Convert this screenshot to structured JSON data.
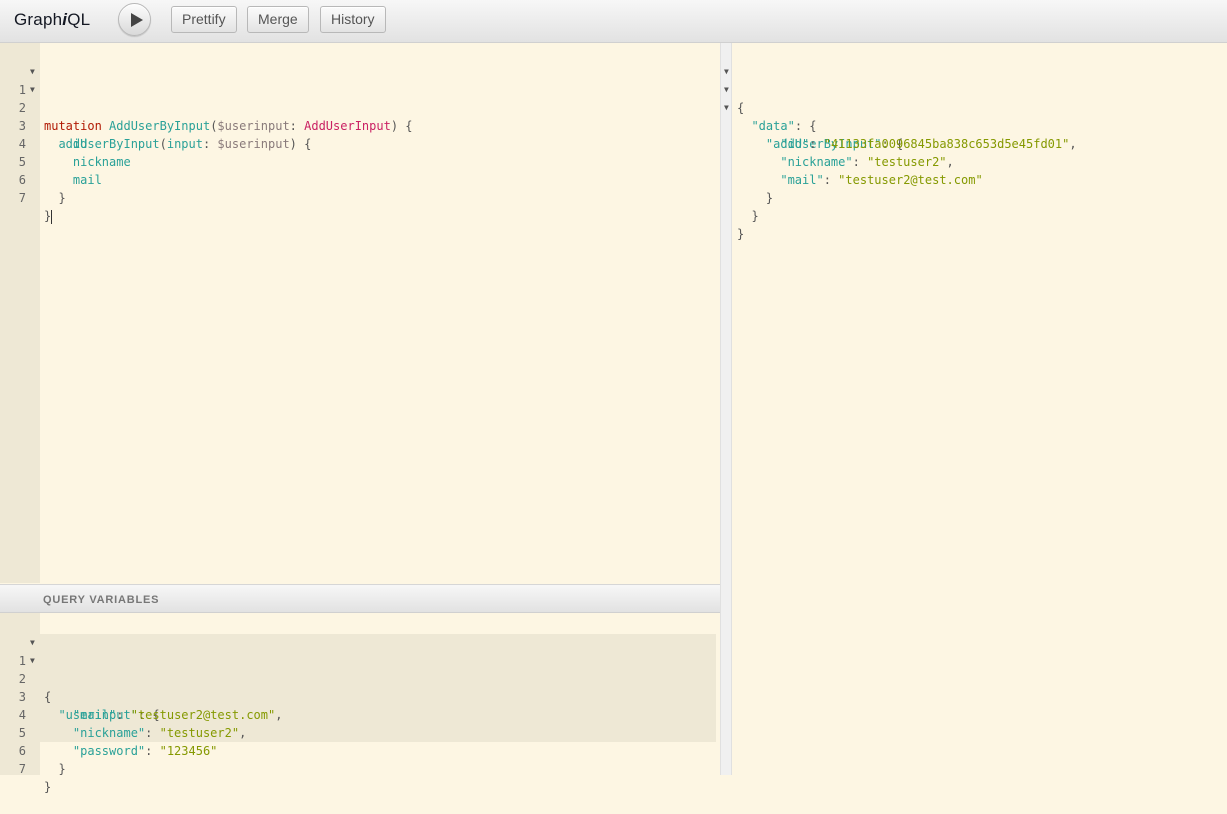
{
  "app": {
    "logo_prefix": "Graph",
    "logo_italic": "i",
    "logo_suffix": "QL"
  },
  "toolbar": {
    "run_label": "",
    "buttons": [
      "Prettify",
      "Merge",
      "History"
    ]
  },
  "query_editor": {
    "line_numbers": [
      "1",
      "2",
      "3",
      "4",
      "5",
      "6",
      "7"
    ],
    "tokens": {
      "l1_kw": "mutation",
      "l1_name": "AddUserByInput",
      "l1_open": "(",
      "l1_var": "$userinput",
      "l1_colon": ": ",
      "l1_type": "AddUserInput",
      "l1_close": ") {",
      "l2_field": "addUserByInput",
      "l2_open": "(",
      "l2_arg": "input",
      "l2_colon": ": ",
      "l2_var": "$userinput",
      "l2_close": ") {",
      "l3": "id",
      "l4": "nickname",
      "l5": "mail",
      "l6": "}",
      "l7": "}"
    }
  },
  "variables_panel": {
    "title": "QUERY VARIABLES",
    "line_numbers": [
      "1",
      "2",
      "3",
      "4",
      "5",
      "6",
      "7"
    ],
    "tokens": {
      "l1": "{",
      "l2_key": "\"userinput\"",
      "l2_rest": ": {",
      "l3_key": "\"mail\"",
      "l3_colon": ": ",
      "l3_val": "\"testuser2@test.com\"",
      "l3_comma": ",",
      "l4_key": "\"nickname\"",
      "l4_colon": ": ",
      "l4_val": "\"testuser2\"",
      "l4_comma": ",",
      "l5_key": "\"password\"",
      "l5_colon": ": ",
      "l5_val": "\"123456\"",
      "l6": "}",
      "l7": "}"
    }
  },
  "result": {
    "tokens": {
      "l1": "{",
      "l2_key": "\"data\"",
      "l2_rest": ": {",
      "l3_key": "\"addUserByInput\"",
      "l3_rest": ": {",
      "l4_key": "\"id\"",
      "l4_colon": ": ",
      "l4_val": "\"41133fa0096845ba838c653d5e45fd01\"",
      "l4_comma": ",",
      "l5_key": "\"nickname\"",
      "l5_colon": ": ",
      "l5_val": "\"testuser2\"",
      "l5_comma": ",",
      "l6_key": "\"mail\"",
      "l6_colon": ": ",
      "l6_val": "\"testuser2@test.com\"",
      "l7": "}",
      "l8": "}",
      "l9": "}"
    }
  },
  "icons": {
    "run": "play-icon",
    "fold": "fold-arrow-icon"
  },
  "colors": {
    "editor_bg": "#fdf6e3",
    "gutter_bg": "#eee8d5",
    "keyword": "#b11a04",
    "definition": "#2aa198",
    "type": "#ca2163",
    "string": "#859900"
  }
}
